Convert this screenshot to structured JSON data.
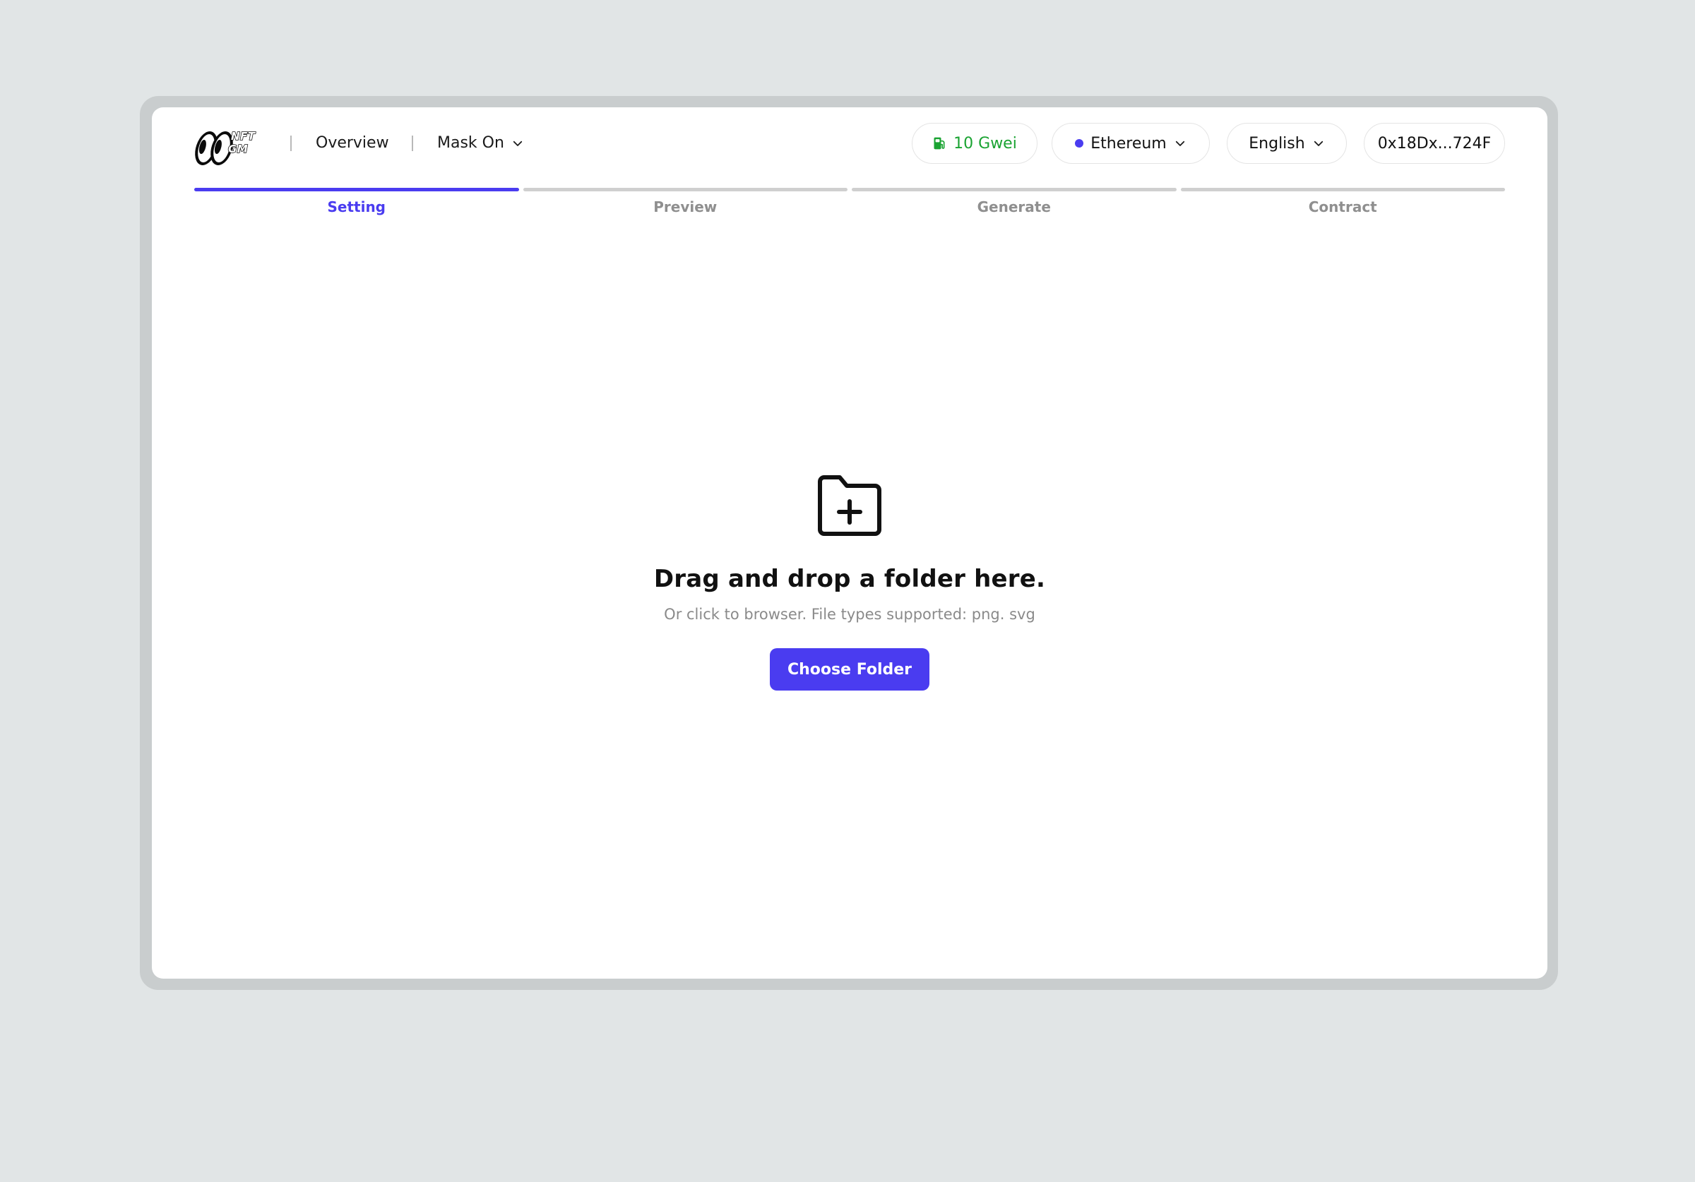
{
  "header": {
    "logo_text_line1": "NFT",
    "logo_text_line2": "GM",
    "nav": {
      "overview": "Overview",
      "mask_on": "Mask On"
    },
    "gas": "10 Gwei",
    "network": "Ethereum",
    "language": "English",
    "wallet": "0x18Dx...724F"
  },
  "steps": [
    {
      "label": "Setting",
      "active": true
    },
    {
      "label": "Preview",
      "active": false
    },
    {
      "label": "Generate",
      "active": false
    },
    {
      "label": "Contract",
      "active": false
    }
  ],
  "drop_zone": {
    "title": "Drag and drop a folder here.",
    "subtitle": "Or click to browser. File types supported: png. svg",
    "button": "Choose Folder"
  },
  "colors": {
    "accent": "#4a3cf0",
    "gas_green": "#1aa332",
    "background": "#e1e5e6"
  },
  "icons": {
    "gas": "gas-pump-icon",
    "network": "status-dot-icon",
    "chevron": "chevron-down-icon",
    "folder": "folder-plus-icon"
  }
}
